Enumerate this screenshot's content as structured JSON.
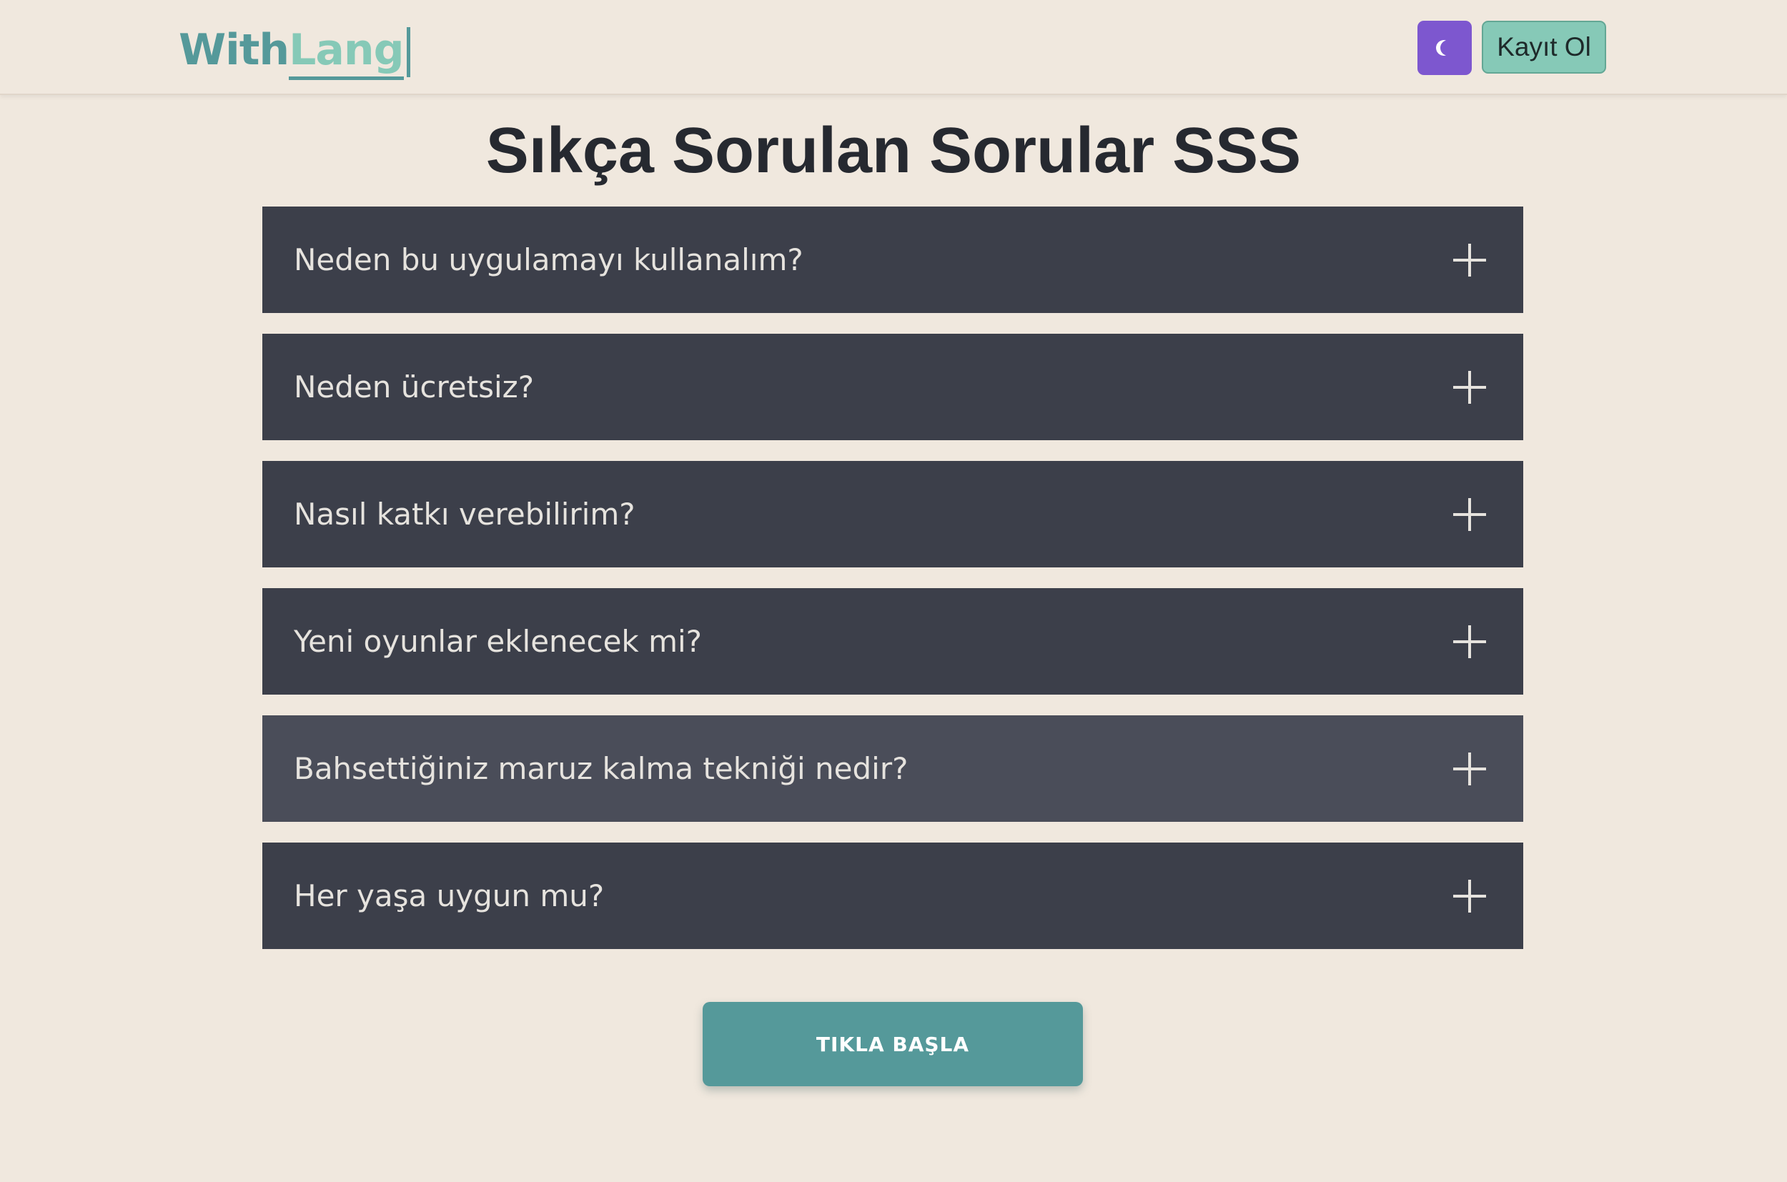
{
  "header": {
    "logo_part1": "With",
    "logo_part2": "Lang",
    "theme_toggle_icon": "moon-icon",
    "signup_label": "Kayıt Ol"
  },
  "main": {
    "title": "Sıkça Sorulan Sorular SSS",
    "faq": [
      {
        "question": "Neden bu uygulamayı kullanalım?"
      },
      {
        "question": "Neden ücretsiz?"
      },
      {
        "question": "Nasıl katkı verebilirim?"
      },
      {
        "question": "Yeni oyunlar eklenecek mi?"
      },
      {
        "question": "Bahsettiğiniz maruz kalma tekniği nedir?"
      },
      {
        "question": "Her yaşa uygun mu?"
      }
    ],
    "cta_label": "TIKLA BAŞLA"
  },
  "colors": {
    "background": "#f0e8de",
    "faq_item": "#3c3f4a",
    "faq_item_hover": "#4a4d59",
    "accent_teal": "#55999a",
    "accent_mint": "#86c9b7",
    "theme_button": "#7d57cf"
  }
}
